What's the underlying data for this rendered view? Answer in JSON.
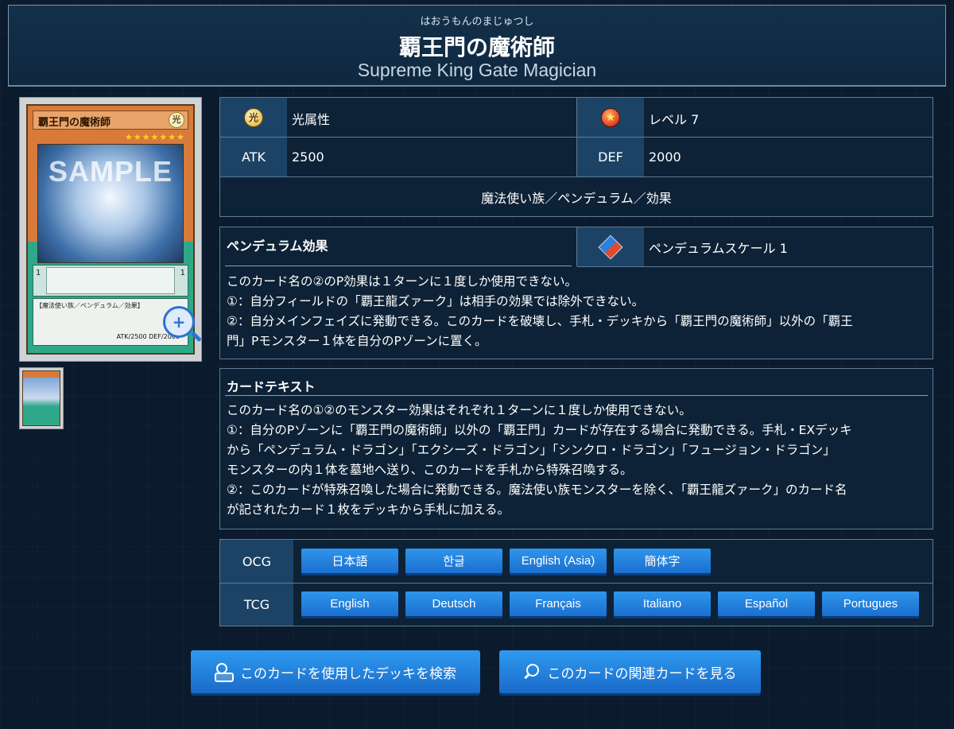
{
  "header": {
    "ruby": "はおうもんのまじゅつし",
    "title_jp": "覇王門の魔術師",
    "title_en": "Supreme King Gate Magician"
  },
  "card_image": {
    "name": "覇王門の魔術師",
    "attribute_glyph": "光",
    "stars": "★★★★★★★",
    "watermark": "SAMPLE",
    "scale_left": "1",
    "scale_right": "1",
    "type_line": "【魔法使い族／ペンデュラム／効果】",
    "stats": "ATK/2500 DEF/2000",
    "zoom_glyph": "+"
  },
  "stats": {
    "attribute_glyph": "光",
    "attribute": "光属性",
    "level_glyph": "★",
    "level": "レベル 7",
    "atk_label": "ATK",
    "atk": "2500",
    "def_label": "DEF",
    "def": "2000",
    "types": "魔法使い族／ペンデュラム／効果"
  },
  "pendulum": {
    "title": "ペンデュラム効果",
    "scale": "ペンデュラムスケール 1",
    "lines": [
      "このカード名の②のP効果は１ターンに１度しか使用できない。",
      "①：自分フィールドの「覇王龍ズァーク」は相手の効果では除外できない。",
      "②：自分メインフェイズに発動できる。このカードを破壊し、手札・デッキから「覇王門の魔術師」以外の「覇王",
      "門」Pモンスター１体を自分のPゾーンに置く。"
    ]
  },
  "card_text": {
    "title": "カードテキスト",
    "lines": [
      "このカード名の①②のモンスター効果はそれぞれ１ターンに１度しか使用できない。",
      "①：自分のPゾーンに「覇王門の魔術師」以外の「覇王門」カードが存在する場合に発動できる。手札・EXデッキ",
      "から「ペンデュラム・ドラゴン」「エクシーズ・ドラゴン」「シンクロ・ドラゴン」「フュージョン・ドラゴン」",
      "モンスターの内１体を墓地へ送り、このカードを手札から特殊召喚する。",
      "②：このカードが特殊召喚した場合に発動できる。魔法使い族モンスターを除く、「覇王龍ズァーク」のカード名",
      "が記されたカード１枚をデッキから手札に加える。"
    ]
  },
  "languages": {
    "ocg_label": "OCG",
    "ocg": [
      "日本語",
      "한글",
      "English (Asia)",
      "簡体字"
    ],
    "tcg_label": "TCG",
    "tcg": [
      "English",
      "Deutsch",
      "Français",
      "Italiano",
      "Español",
      "Portugues"
    ]
  },
  "actions": {
    "search_decks": "このカードを使用したデッキを検索",
    "related_cards": "このカードの関連カードを見る"
  }
}
